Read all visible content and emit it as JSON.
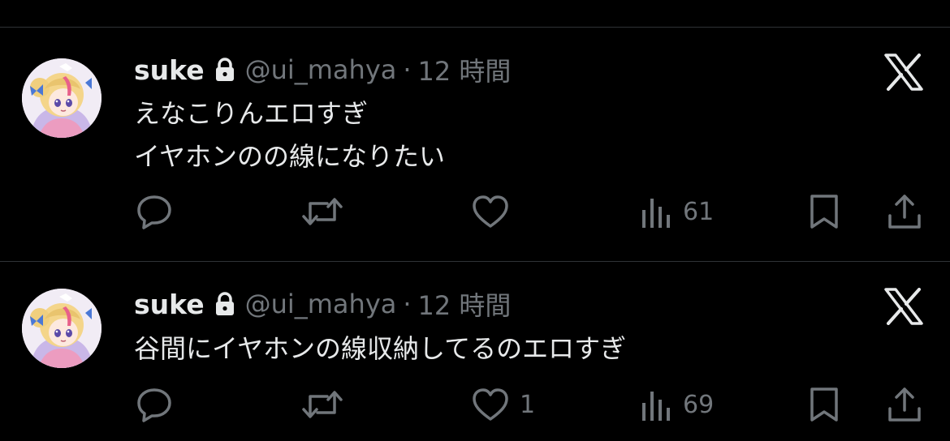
{
  "tweets": [
    {
      "author": {
        "name": "suke",
        "handle": "@ui_mahya",
        "avatar": "anime-girl-avatar",
        "protected_icon": "lock-icon"
      },
      "separator": "·",
      "time": "12 時間",
      "text_lines": [
        "えなこりんエロすぎ",
        "イヤホンのの線になりたい"
      ],
      "counts": {
        "reply": "",
        "retweet": "",
        "like": "",
        "views": "61"
      }
    },
    {
      "author": {
        "name": "suke",
        "handle": "@ui_mahya",
        "avatar": "anime-girl-avatar",
        "protected_icon": "lock-icon"
      },
      "separator": "·",
      "time": "12 時間",
      "text_lines": [
        "谷間にイヤホンの線収納してるのエロすぎ"
      ],
      "counts": {
        "reply": "",
        "retweet": "",
        "like": "1",
        "views": "69"
      }
    }
  ],
  "icons": {
    "brand": "x-logo-icon",
    "reply": "reply-icon",
    "retweet": "retweet-icon",
    "like": "heart-icon",
    "views": "views-chart-icon",
    "bookmark": "bookmark-icon",
    "share": "share-icon"
  },
  "colors": {
    "background": "#000000",
    "primary_text": "#e7e9ea",
    "secondary_text": "#71767b",
    "divider": "#2f3336"
  }
}
